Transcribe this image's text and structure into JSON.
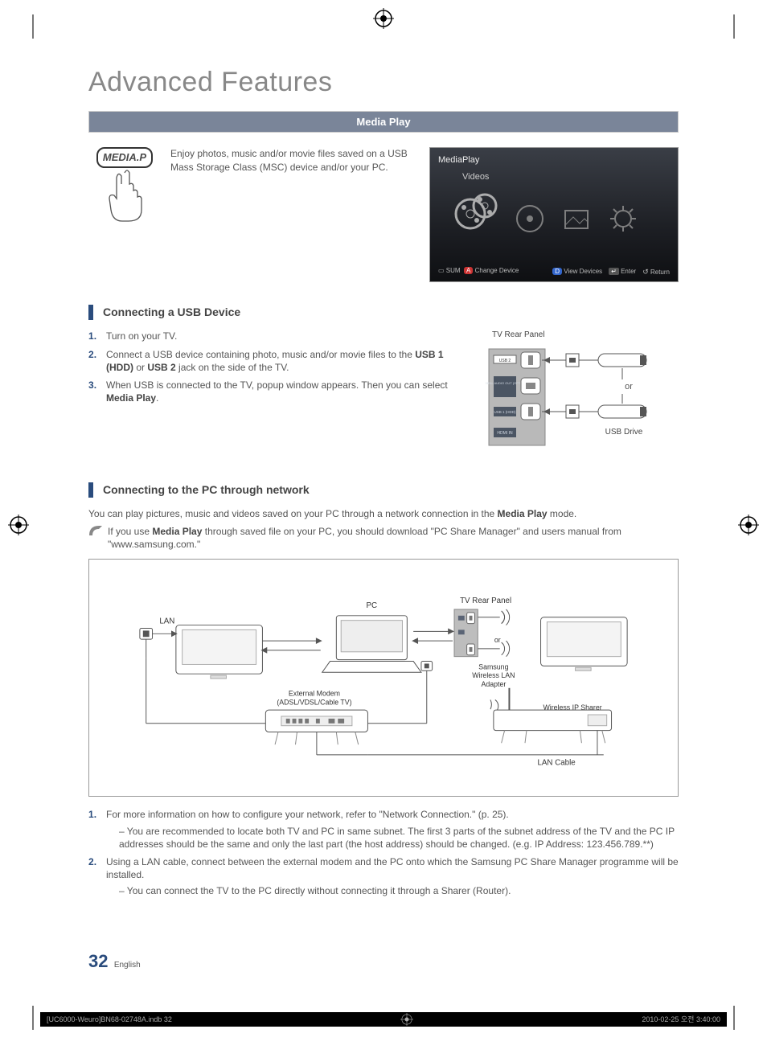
{
  "page": {
    "title": "Advanced Features",
    "section_bar": "Media Play",
    "page_number": "32",
    "language": "English"
  },
  "intro": {
    "button_label": "MEDIA.P",
    "text": "Enjoy photos, music and/or movie files saved on a USB Mass Storage Class (MSC) device and/or your PC."
  },
  "mediaplay_ui": {
    "title": "MediaPlay",
    "subtitle": "Videos",
    "footer_left_sum": "SUM",
    "footer_left_a": "A",
    "footer_left_change": "Change Device",
    "footer_d": "D",
    "footer_view": "View Devices",
    "footer_enter_icon": "↵",
    "footer_enter": "Enter",
    "footer_return_icon": "↺",
    "footer_return": "Return"
  },
  "usb": {
    "heading": "Connecting a USB Device",
    "steps": [
      "Turn on your TV.",
      "Connect a USB device containing photo, music and/or movie files to the USB 1 (HDD) or USB 2 jack on the side of the TV.",
      "When USB is connected to the TV, popup window appears. Then you can select Media Play."
    ],
    "bold_tokens": {
      "usb1": "USB 1 (HDD)",
      "usb2": "USB 2",
      "mediaplay": "Media Play"
    },
    "panel_label": "TV Rear Panel",
    "ports": {
      "usb2": "USB 2",
      "digital": "DIGITAL AUDIO OUT (OPTICAL)",
      "usb1": "USB 1 (HDD)",
      "hdmi": "HDMI IN"
    },
    "or": "or",
    "usb_drive": "USB Drive"
  },
  "pc": {
    "heading": "Connecting to the PC through network",
    "intro": "You can play pictures, music and videos saved on your PC through a network connection in the Media Play mode.",
    "intro_bold": "Media Play",
    "note_prefix": "If you use ",
    "note_bold": "Media Play",
    "note_rest": " through saved file on your PC, you should download \"PC Share Manager\" and users manual from \"www.samsung.com.\"",
    "diagram": {
      "lan": "LAN",
      "pc": "PC",
      "tv_rear": "TV Rear Panel",
      "or": "or",
      "adapter": "Samsung Wireless LAN Adapter",
      "modem": "External Modem (ADSL/VDSL/Cable TV)",
      "sharer": "Wireless IP Sharer",
      "lan_cable": "LAN Cable"
    },
    "steps": [
      {
        "main": "For more information on how to configure your network, refer to \"Network Connection.\" (p. 25).",
        "sub": "You are recommended to locate both TV and PC in same subnet. The first 3 parts of the subnet address of the TV and the PC IP addresses should be the same and only the last part (the host address) should be changed. (e.g. IP Address: 123.456.789.**)"
      },
      {
        "main": "Using a LAN cable, connect between the external modem and the PC onto which the Samsung PC Share Manager programme will be installed.",
        "sub": "You can connect the TV to the PC directly without connecting it through a Sharer (Router)."
      }
    ]
  },
  "print": {
    "file": "[UC6000-Weuro]BN68-02748A.indb   32",
    "date": "2010-02-25   오전 3:40:00"
  }
}
